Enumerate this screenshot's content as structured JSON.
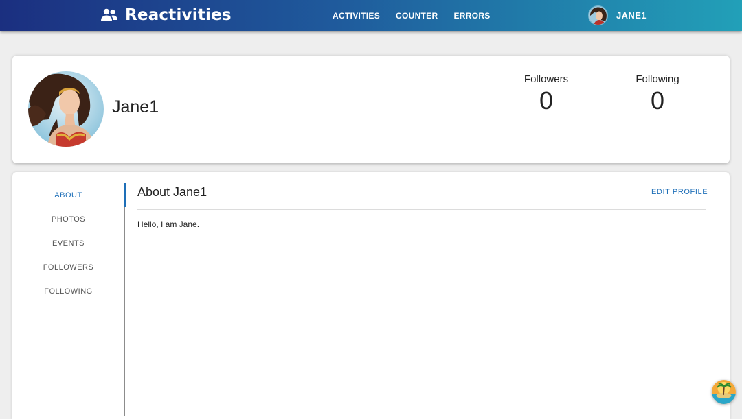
{
  "app": {
    "title": "Reactivities",
    "brand_icon": "people-icon"
  },
  "nav": {
    "links": [
      {
        "label": "ACTIVITIES"
      },
      {
        "label": "COUNTER"
      },
      {
        "label": "ERRORS"
      }
    ]
  },
  "user_menu": {
    "name": "JANE1"
  },
  "profile": {
    "name": "Jane1",
    "followers_label": "Followers",
    "followers_count": "0",
    "following_label": "Following",
    "following_count": "0"
  },
  "tabs": [
    {
      "label": "ABOUT",
      "active": true
    },
    {
      "label": "PHOTOS",
      "active": false
    },
    {
      "label": "EVENTS",
      "active": false
    },
    {
      "label": "FOLLOWERS",
      "active": false
    },
    {
      "label": "FOLLOWING",
      "active": false
    }
  ],
  "about": {
    "title": "About Jane1",
    "edit_label": "EDIT PROFILE",
    "bio": "Hello, I am Jane."
  },
  "colors": {
    "accent": "#1e6fb8",
    "nav_gradient_start": "#1b2f80",
    "nav_gradient_end": "#22a0b8"
  }
}
